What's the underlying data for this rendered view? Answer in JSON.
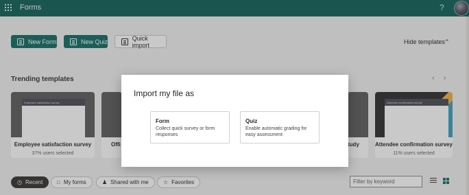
{
  "app": {
    "title": "Forms",
    "help": "?"
  },
  "toolbar": {
    "new_form": "New Form",
    "new_quiz": "New Quiz",
    "quick_import": "Quick import",
    "hide_templates": "Hide templates"
  },
  "templates": {
    "title": "Trending templates",
    "cards": [
      {
        "label": "Employee satisfaction survey",
        "sub": "37% users selected",
        "thumb_title": "Employee satisfaction survey"
      },
      {
        "label": "Offi",
        "sub": "",
        "thumb_title": ""
      },
      {
        "label": "tudy",
        "sub": "",
        "thumb_title": ""
      },
      {
        "label": "Attendee confirmation survey",
        "sub": "11% users selected",
        "thumb_title": "Attendee confirmation survey"
      }
    ]
  },
  "filters": {
    "recent": "Recent",
    "my_forms": "My forms",
    "shared": "Shared with me",
    "favorites": "Favorites",
    "search_placeholder": "Filter by keyword"
  },
  "dialog": {
    "title": "Import my file as",
    "options": [
      {
        "title": "Form",
        "desc": "Collect quick survey or form responses"
      },
      {
        "title": "Quiz",
        "desc": "Enable automatic grading for easy assessment"
      }
    ]
  },
  "colors": {
    "header": "#0f5f57",
    "primary": "#0f6b61"
  }
}
